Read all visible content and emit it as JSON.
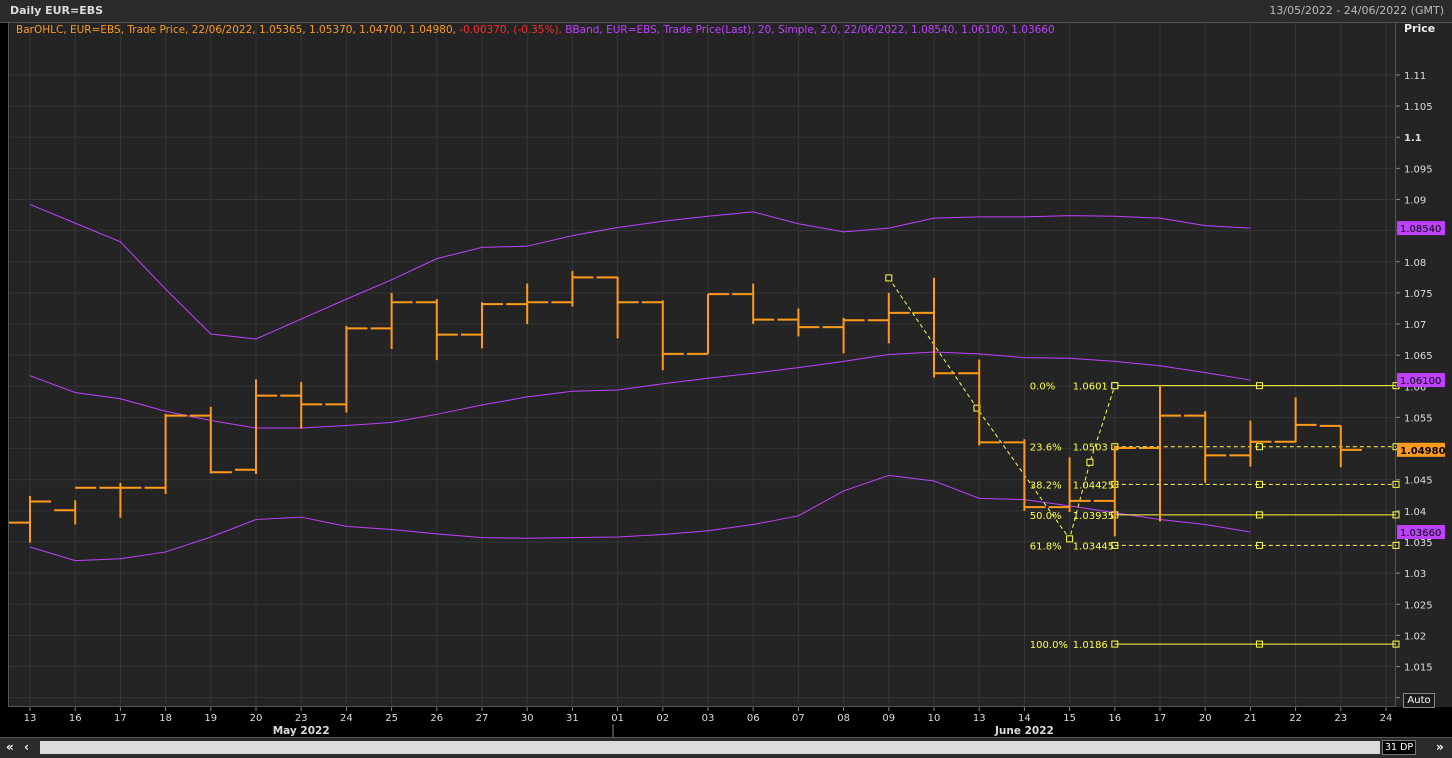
{
  "window": {
    "title": "Daily EUR=EBS",
    "date_range": "13/05/2022 - 24/06/2022 (GMT)",
    "auto_label": "Auto",
    "dp_label": "31 DP",
    "nav_first": "«",
    "nav_prev": "‹",
    "nav_last": "»"
  },
  "legend": {
    "ohlc_prefix": "BarOHLC, EUR=EBS, Trade Price, 22/06/2022, 1.05365, 1.05370, 1.04700, 1.04980,",
    "ohlc_change": " -0.00370, (-0.35%),",
    "bband": " BBand, EUR=EBS, Trade Price(Last), 20, Simple, 2.0, 22/06/2022, 1.08540, 1.06100, 1.03660",
    "ohlc_color": "#ff9a1a",
    "change_color": "#ff2a2a",
    "bband_color": "#c040ff"
  },
  "colors": {
    "bar": "#ff9a1a",
    "bband": "#c040ff",
    "fib": "#ffff40",
    "grid": "#353535"
  },
  "chart_data": {
    "type": "ohlc",
    "ylabel": "Price",
    "ylim": [
      1.0085,
      1.1185
    ],
    "yticks": [
      1.01,
      1.015,
      1.02,
      1.025,
      1.03,
      1.035,
      1.04,
      1.045,
      1.05,
      1.055,
      1.06,
      1.065,
      1.07,
      1.075,
      1.08,
      1.085,
      1.09,
      1.095,
      1.1,
      1.105,
      1.11
    ],
    "ytick_labels": [
      "1.01",
      "1.015",
      "1.02",
      "1.025",
      "1.03",
      "1.035",
      "1.04",
      "1.045",
      "1.05",
      "1.055",
      "1.06",
      "1.065",
      "1.07",
      "1.075",
      "1.08",
      "1.085",
      "1.09",
      "1.095",
      "1.1",
      "1.105",
      "1.11"
    ],
    "x_tick_labels": [
      "13",
      "16",
      "17",
      "18",
      "19",
      "20",
      "23",
      "24",
      "25",
      "26",
      "27",
      "30",
      "31",
      "01",
      "02",
      "03",
      "06",
      "07",
      "08",
      "09",
      "10",
      "13",
      "14",
      "15",
      "16",
      "17",
      "20",
      "21",
      "22",
      "23",
      "24"
    ],
    "month_labels": [
      {
        "label": "May 2022",
        "slot": 6
      },
      {
        "label": "June 2022",
        "slot": 22
      }
    ],
    "bars": [
      {
        "o": 1.0381,
        "h": 1.0424,
        "l": 1.0349,
        "c": 1.0415
      },
      {
        "o": 1.0401,
        "h": 1.0417,
        "l": 1.0378,
        "c": 1.0437
      },
      {
        "o": 1.0437,
        "h": 1.0445,
        "l": 1.0389,
        "c": 1.0437
      },
      {
        "o": 1.0437,
        "h": 1.0556,
        "l": 1.0427,
        "c": 1.0553
      },
      {
        "o": 1.0553,
        "h": 1.0567,
        "l": 1.046,
        "c": 1.0462
      },
      {
        "o": 1.0466,
        "h": 1.0611,
        "l": 1.0459,
        "c": 1.0585
      },
      {
        "o": 1.0585,
        "h": 1.0607,
        "l": 1.0532,
        "c": 1.0571
      },
      {
        "o": 1.0571,
        "h": 1.0697,
        "l": 1.0558,
        "c": 1.0693
      },
      {
        "o": 1.0693,
        "h": 1.075,
        "l": 1.066,
        "c": 1.0735
      },
      {
        "o": 1.0735,
        "h": 1.074,
        "l": 1.0642,
        "c": 1.0683
      },
      {
        "o": 1.0683,
        "h": 1.0735,
        "l": 1.0661,
        "c": 1.0732
      },
      {
        "o": 1.0732,
        "h": 1.0765,
        "l": 1.07,
        "c": 1.0735
      },
      {
        "o": 1.0735,
        "h": 1.0785,
        "l": 1.0728,
        "c": 1.0775
      },
      {
        "o": 1.0775,
        "h": 1.0776,
        "l": 1.0677,
        "c": 1.0735
      },
      {
        "o": 1.0735,
        "h": 1.0738,
        "l": 1.0626,
        "c": 1.0652
      },
      {
        "o": 1.0652,
        "h": 1.0748,
        "l": 1.0652,
        "c": 1.0748
      },
      {
        "o": 1.0748,
        "h": 1.0765,
        "l": 1.07,
        "c": 1.0707
      },
      {
        "o": 1.0707,
        "h": 1.0725,
        "l": 1.068,
        "c": 1.0695
      },
      {
        "o": 1.0695,
        "h": 1.071,
        "l": 1.0653,
        "c": 1.0706
      },
      {
        "o": 1.0706,
        "h": 1.075,
        "l": 1.0669,
        "c": 1.0718
      },
      {
        "o": 1.0718,
        "h": 1.0774,
        "l": 1.0614,
        "c": 1.0621
      },
      {
        "o": 1.0621,
        "h": 1.0643,
        "l": 1.0505,
        "c": 1.051
      },
      {
        "o": 1.051,
        "h": 1.0515,
        "l": 1.04,
        "c": 1.0406
      },
      {
        "o": 1.0406,
        "h": 1.0486,
        "l": 1.0398,
        "c": 1.0416
      },
      {
        "o": 1.0416,
        "h": 1.0505,
        "l": 1.0359,
        "c": 1.0501
      },
      {
        "o": 1.0501,
        "h": 1.0601,
        "l": 1.0383,
        "c": 1.0553
      },
      {
        "o": 1.0553,
        "h": 1.056,
        "l": 1.0445,
        "c": 1.0489
      },
      {
        "o": 1.0489,
        "h": 1.0545,
        "l": 1.0471,
        "c": 1.0511
      },
      {
        "o": 1.0511,
        "h": 1.0582,
        "l": 1.051,
        "c": 1.0538
      },
      {
        "o": 1.05365,
        "h": 1.0537,
        "l": 1.047,
        "c": 1.0498
      }
    ],
    "bband_upper": [
      1.0892,
      1.0862,
      1.0832,
      1.0756,
      1.0684,
      1.0676,
      1.0708,
      1.074,
      1.0771,
      1.0805,
      1.0823,
      1.0825,
      1.0842,
      1.0855,
      1.0865,
      1.0873,
      1.088,
      1.0861,
      1.0848,
      1.0854,
      1.087,
      1.0872,
      1.0872,
      1.0874,
      1.0873,
      1.087,
      1.0858,
      1.0854
    ],
    "bband_mid": [
      1.0617,
      1.059,
      1.058,
      1.056,
      1.0545,
      1.0533,
      1.0533,
      1.0537,
      1.0542,
      1.0555,
      1.057,
      1.0583,
      1.0592,
      1.0594,
      1.0604,
      1.0613,
      1.0621,
      1.063,
      1.064,
      1.0651,
      1.0655,
      1.0652,
      1.0646,
      1.0645,
      1.064,
      1.0633,
      1.0622,
      1.061
    ],
    "bband_lower": [
      1.0342,
      1.032,
      1.0323,
      1.0334,
      1.0358,
      1.0386,
      1.039,
      1.0375,
      1.037,
      1.0363,
      1.0357,
      1.0356,
      1.0357,
      1.0358,
      1.0362,
      1.0368,
      1.0378,
      1.0392,
      1.0432,
      1.0457,
      1.0448,
      1.042,
      1.0418,
      1.0408,
      1.0397,
      1.0386,
      1.0378,
      1.0366
    ],
    "price_tags": [
      {
        "label": "1.08540",
        "value": 1.0854,
        "color": "#c040ff"
      },
      {
        "label": "1.06100",
        "value": 1.061,
        "color": "#c040ff"
      },
      {
        "label": "1.04980",
        "value": 1.0498,
        "color": "#ff9a1a"
      },
      {
        "label": "1.03660",
        "value": 1.0366,
        "color": "#c040ff"
      }
    ],
    "fib_levels": [
      {
        "pct": "0.0%",
        "value": 1.0601,
        "label": "1.0601",
        "dashed": false
      },
      {
        "pct": "23.6%",
        "value": 1.0503,
        "label": "1.0503",
        "dashed": true
      },
      {
        "pct": "38.2%",
        "value": 1.04425,
        "label": "1.04425",
        "dashed": true
      },
      {
        "pct": "50.0%",
        "value": 1.03935,
        "label": "1.03935",
        "dashed": false
      },
      {
        "pct": "61.8%",
        "value": 1.03445,
        "label": "1.03445",
        "dashed": true
      },
      {
        "pct": "100.0%",
        "value": 1.0186,
        "label": "1.0186",
        "dashed": false
      }
    ],
    "fib_trend": [
      {
        "slot": 19,
        "value": 1.0774
      },
      {
        "slot": 20.95,
        "value": 1.0565
      },
      {
        "slot": 23,
        "value": 1.0355
      },
      {
        "slot": 23.45,
        "value": 1.0478
      },
      {
        "slot": 24,
        "value": 1.0601
      }
    ]
  }
}
